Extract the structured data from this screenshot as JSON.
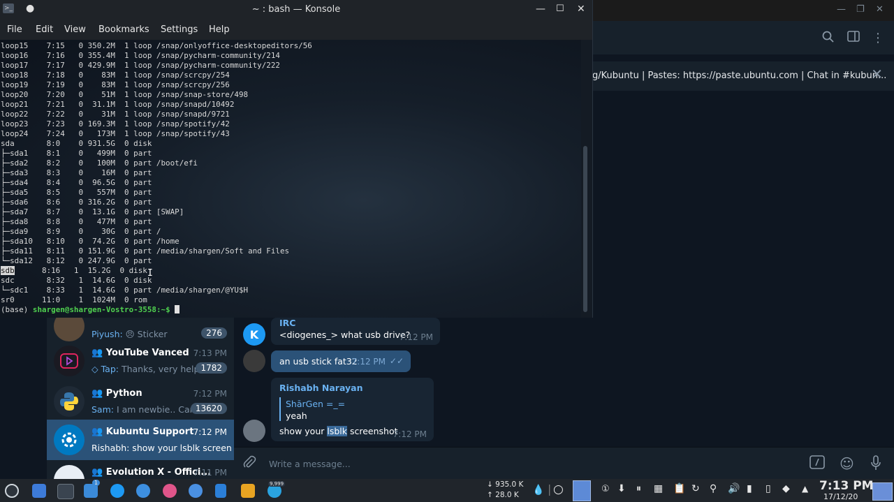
{
  "konsole": {
    "title": "~ : bash — Konsole",
    "menu": [
      "File",
      "Edit",
      "View",
      "Bookmarks",
      "Settings",
      "Help"
    ],
    "lines": [
      "loop15    7:15   0 350.2M  1 loop /snap/onlyoffice-desktopeditors/56",
      "loop16    7:16   0 355.4M  1 loop /snap/pycharm-community/214",
      "loop17    7:17   0 429.9M  1 loop /snap/pycharm-community/222",
      "loop18    7:18   0    83M  1 loop /snap/scrcpy/254",
      "loop19    7:19   0    83M  1 loop /snap/scrcpy/256",
      "loop20    7:20   0    51M  1 loop /snap/snap-store/498",
      "loop21    7:21   0  31.1M  1 loop /snap/snapd/10492",
      "loop22    7:22   0    31M  1 loop /snap/snapd/9721",
      "loop23    7:23   0 169.3M  1 loop /snap/spotify/42",
      "loop24    7:24   0   173M  1 loop /snap/spotify/43",
      "sda       8:0    0 931.5G  0 disk",
      "├─sda1    8:1    0   499M  0 part",
      "├─sda2    8:2    0   100M  0 part /boot/efi",
      "├─sda3    8:3    0    16M  0 part",
      "├─sda4    8:4    0  96.5G  0 part",
      "├─sda5    8:5    0   557M  0 part",
      "├─sda6    8:6    0 316.2G  0 part",
      "├─sda7    8:7    0  13.1G  0 part [SWAP]",
      "├─sda8    8:8    0   477M  0 part",
      "├─sda9    8:9    0    30G  0 part /",
      "├─sda10   8:10   0  74.2G  0 part /home",
      "├─sda11   8:11   0 151.9G  0 part /media/shargen/Soft and Files",
      "└─sda12   8:12   0 247.9G  0 part"
    ],
    "sdb_name": "sdb",
    "sdb_rest": "8:16   1  15.2G  0 disk",
    "tail_lines": [
      "sdc       8:32   1  14.6G  0 disk",
      "└─sdc1    8:33   1  14.6G  0 part /media/shargen/@YU$H",
      "sr0      11:0    1  1024M  0 rom"
    ],
    "prompt_env": "(base) ",
    "prompt_user": "shargen@shargen-Vostro-3558",
    "prompt_path": ":~$ "
  },
  "telegram": {
    "pinned_text": "g/Kubuntu | Pastes: https://paste.ubuntu.com | Chat in #kubun...",
    "chats": [
      {
        "prev_who": "Piyush:",
        "prev": " 😠 Sticker",
        "badge": "276"
      },
      {
        "name": "YouTube Vanced",
        "time": "7:13 PM",
        "prev_who": "◇ Tap:",
        "prev": " Thanks, very help...",
        "badge": "1782"
      },
      {
        "name": "Python",
        "time": "7:12 PM",
        "prev_who": "Sam:",
        "prev": " I am newbie.. Can i...",
        "badge": "13620"
      },
      {
        "name": "Kubuntu Support",
        "time": "7:12 PM",
        "prev_who": "Rishabh:",
        "prev": " show your lsblk screen..."
      },
      {
        "name": "Evolution X - Offici...",
        "time": "7:11 PM"
      }
    ],
    "messages": {
      "irc_sender": "IRC",
      "irc_text": "<diogenes_> what usb drive?",
      "irc_time": "7:12 PM",
      "out_text": "an usb stick fat32",
      "out_time": "7:12 PM",
      "reply_sender": "Rishabh Narayan",
      "quote_sender": "ShārGen =_=",
      "quote_text": "yeah",
      "reply_pre": "show your ",
      "reply_hl": "lsblk",
      "reply_post": " screenshot",
      "reply_time": "7:12 PM"
    },
    "input_placeholder": "Write a message..."
  },
  "taskbar": {
    "net_down": "↓ 935.0 K",
    "net_up": "↑ 28.0 K",
    "clock_time": "7:13 PM",
    "clock_date": "17/12/20",
    "badge_files": "1",
    "badge_app": "9,999"
  }
}
